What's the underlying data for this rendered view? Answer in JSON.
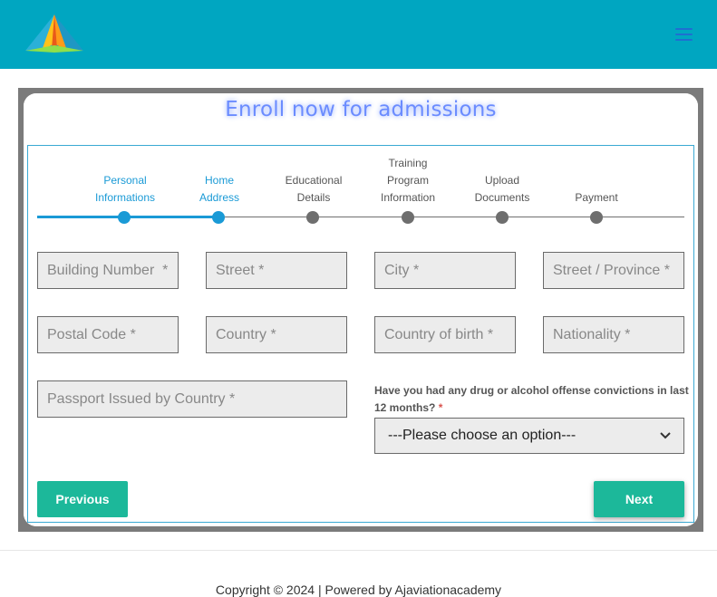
{
  "colors": {
    "header_bg": "#00a6c1",
    "accent": "#1a9ad6",
    "button": "#1cb89a",
    "title": "#6b8cff"
  },
  "header": {
    "logo_icon": "paper-plane-logo-icon",
    "menu_icon": "hamburger-menu-icon"
  },
  "form": {
    "title": "Enroll now for admissions",
    "steps": [
      {
        "line1": "Personal",
        "line2": "Informations",
        "active": true
      },
      {
        "line1": "Home",
        "line2": "Address",
        "active": true
      },
      {
        "line1": "Educational",
        "line2": "Details",
        "active": false
      },
      {
        "line1": "Training",
        "line2": "Program",
        "line3": "Information",
        "active": false
      },
      {
        "line1": "Upload",
        "line2": "Documents",
        "active": false
      },
      {
        "line1": "",
        "line2": "Payment",
        "active": false
      }
    ],
    "fields": {
      "building_number": "Building Number  *",
      "street": "Street *",
      "city": "City *",
      "street_province": "Street / Province *",
      "postal_code": "Postal Code *",
      "country": "Country *",
      "country_of_birth": "Country of birth *",
      "nationality": "Nationality *",
      "passport_issued": "Passport Issued by Country *"
    },
    "question": {
      "text": "Have you had any drug or alcohol offense convictions in last 12 months?",
      "required_mark": "*"
    },
    "select": {
      "selected": "---Please choose an option---"
    },
    "buttons": {
      "previous": "Previous",
      "next": "Next"
    }
  },
  "footer": {
    "text": "Copyright © 2024 | Powered by Ajaviationacademy"
  }
}
